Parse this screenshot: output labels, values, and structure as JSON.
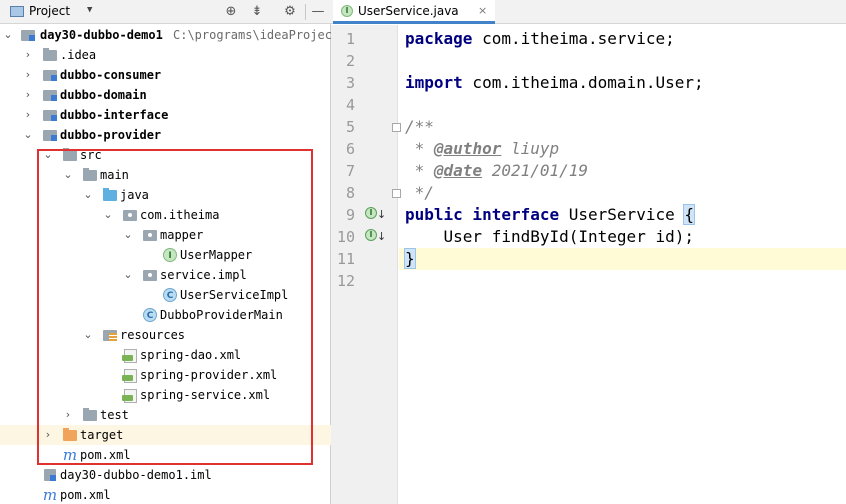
{
  "project_panel": {
    "title": "Project",
    "toolbar": [
      "locate-icon",
      "collapse-icon",
      "gear-icon",
      "hide-icon"
    ]
  },
  "tree": [
    {
      "label": "day30-dubbo-demo1",
      "path": "C:\\programs\\ideaProject",
      "expanded": true,
      "icon": "module-icon"
    },
    {
      "label": ".idea",
      "expanded": false,
      "icon": "folder-icon"
    },
    {
      "label": "dubbo-consumer",
      "expanded": false,
      "icon": "module-icon"
    },
    {
      "label": "dubbo-domain",
      "expanded": false,
      "icon": "module-icon"
    },
    {
      "label": "dubbo-interface",
      "expanded": false,
      "icon": "module-icon"
    },
    {
      "label": "dubbo-provider",
      "expanded": true,
      "icon": "module-icon"
    },
    {
      "label": "src",
      "expanded": true,
      "icon": "folder-icon"
    },
    {
      "label": "main",
      "expanded": true,
      "icon": "folder-icon"
    },
    {
      "label": "java",
      "expanded": true,
      "icon": "source-folder-icon"
    },
    {
      "label": "com.itheima",
      "expanded": true,
      "icon": "package-icon"
    },
    {
      "label": "mapper",
      "expanded": true,
      "icon": "package-icon"
    },
    {
      "label": "UserMapper",
      "icon": "interface-icon"
    },
    {
      "label": "service.impl",
      "expanded": true,
      "icon": "package-icon"
    },
    {
      "label": "UserServiceImpl",
      "icon": "class-icon"
    },
    {
      "label": "DubboProviderMain",
      "icon": "class-icon"
    },
    {
      "label": "resources",
      "expanded": true,
      "icon": "resources-folder-icon"
    },
    {
      "label": "spring-dao.xml",
      "icon": "spring-xml-icon"
    },
    {
      "label": "spring-provider.xml",
      "icon": "spring-xml-icon"
    },
    {
      "label": "spring-service.xml",
      "icon": "spring-xml-icon"
    },
    {
      "label": "test",
      "expanded": false,
      "icon": "folder-icon"
    },
    {
      "label": "target",
      "expanded": false,
      "icon": "excluded-folder-icon"
    },
    {
      "label": "pom.xml",
      "icon": "maven-icon"
    },
    {
      "label": "day30-dubbo-demo1.iml",
      "icon": "iml-icon"
    },
    {
      "label": "pom.xml",
      "icon": "maven-icon"
    }
  ],
  "editor": {
    "tab": {
      "label": "UserService.java",
      "close": "×"
    },
    "lines": [
      {
        "num": "1",
        "kw": "package",
        "text": " com.itheima.service;"
      },
      {
        "num": "2"
      },
      {
        "num": "3",
        "kw": "import",
        "text": " com.itheima.domain.User;"
      },
      {
        "num": "4"
      },
      {
        "num": "5",
        "comment": "/**"
      },
      {
        "num": "6",
        "comment": " * ",
        "tag": "@author",
        "tagval": " liuyp"
      },
      {
        "num": "7",
        "comment": " * ",
        "tag": "@date",
        "tagval": " 2021/01/19"
      },
      {
        "num": "8",
        "comment": " */"
      },
      {
        "num": "9",
        "kw": "public",
        "kw2": " interface",
        "text": " UserService ",
        "brace": "{"
      },
      {
        "num": "10",
        "text": "    User findById(Integer id);"
      },
      {
        "num": "11",
        "brace": "}"
      },
      {
        "num": "12"
      }
    ]
  },
  "colors": {
    "keyword": "#000080",
    "comment": "#808080",
    "selection_box": "#e03030",
    "tab_underline": "#4083c9"
  }
}
